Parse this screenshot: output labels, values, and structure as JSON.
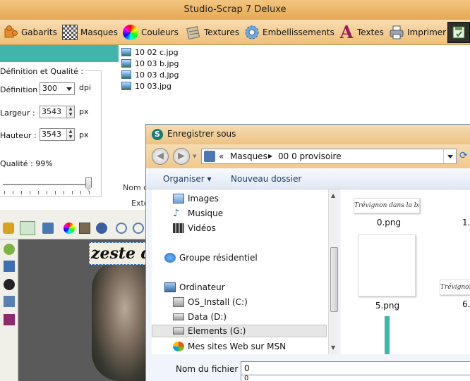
{
  "app": {
    "title": "Studio-Scrap 7 Deluxe"
  },
  "toolbar": {
    "items": [
      {
        "label": "Gabarits",
        "icon": "puzzle-icon"
      },
      {
        "label": "Masques",
        "icon": "checker-icon"
      },
      {
        "label": "Couleurs",
        "icon": "color-wheel-icon"
      },
      {
        "label": "Textures",
        "icon": "texture-icon"
      },
      {
        "label": "Embellissements",
        "icon": "gear-flower-icon"
      },
      {
        "label": "Textes",
        "icon": "letter-a-icon"
      },
      {
        "label": "Imprimer",
        "icon": "printer-icon"
      }
    ]
  },
  "settings": {
    "group_title": "Définition et Qualité :",
    "definition_label": "Définition :",
    "definition_value": "300",
    "definition_unit": "dpi",
    "width_label": "Largeur :",
    "width_value": "3543",
    "width_unit": "px",
    "height_label": "Hauteur :",
    "height_value": "3543",
    "height_unit": "px",
    "quality_label": "Qualité : 99%",
    "quality_level": 0.99
  },
  "files": [
    "10 02 c.jpg",
    "10 03 b.jpg",
    "10 03 d.jpg",
    "10 03.jpg"
  ],
  "side_labels": {
    "nom": "Nom d",
    "ext": "Exte"
  },
  "canvas": {
    "text": "zeste d'"
  },
  "dialog": {
    "title": "Enregistrer sous",
    "breadcrumb": [
      "«",
      "Masques",
      "00 0 provisoire"
    ],
    "commands": {
      "organize": "Organiser ▾",
      "new_folder": "Nouveau dossier"
    },
    "nav": [
      {
        "label": "Images",
        "icon": "images-folder-icon"
      },
      {
        "label": "Musique",
        "icon": "music-note-icon"
      },
      {
        "label": "Vidéos",
        "icon": "videos-icon"
      },
      {
        "label": "Groupe résidentiel",
        "icon": "homegroup-icon"
      },
      {
        "label": "Ordinateur",
        "icon": "computer-icon"
      },
      {
        "label": "OS_Install (C:)",
        "icon": "drive-c-icon"
      },
      {
        "label": "Data (D:)",
        "icon": "drive-icon"
      },
      {
        "label": "Elements (G:)",
        "icon": "drive-icon"
      },
      {
        "label": "Mes sites Web sur MSN",
        "icon": "msn-icon"
      }
    ],
    "thumbnails": [
      {
        "name": "0.png",
        "preview_text": "Trévignon dans la brume"
      },
      {
        "name": "1.",
        "preview_text": ""
      },
      {
        "name": "5.png",
        "preview_text": ""
      },
      {
        "name": "6.",
        "preview_text": "Trévignon d"
      }
    ],
    "filename_label": "Nom du fichier :",
    "filename_value": "0",
    "autocomplete_value": "0"
  }
}
